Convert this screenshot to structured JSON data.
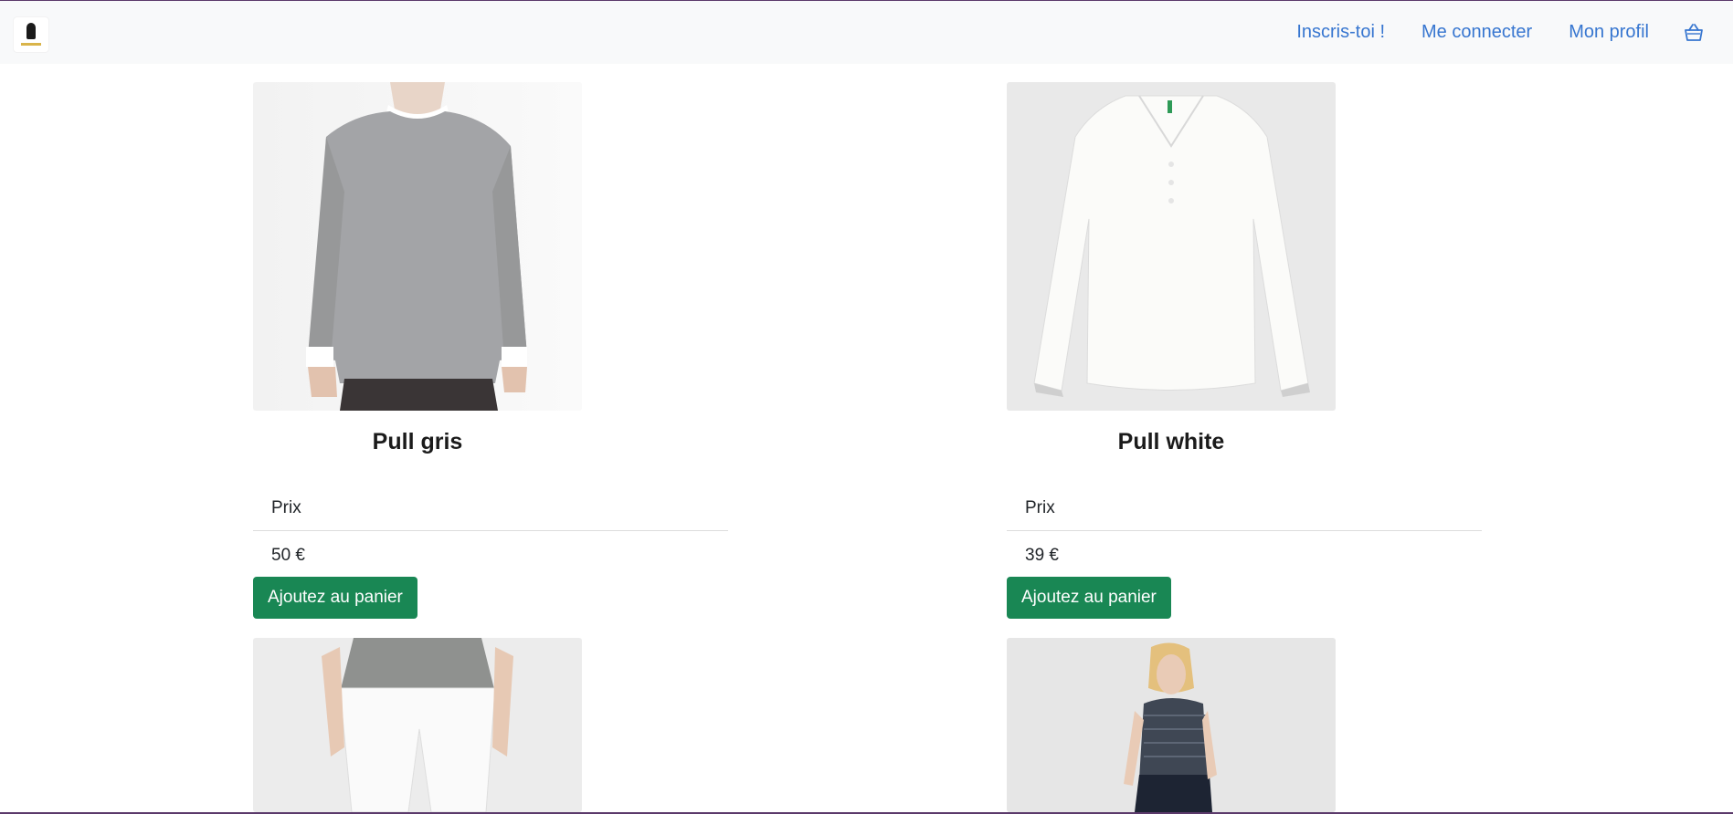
{
  "navbar": {
    "links": [
      "Inscris-toi !",
      "Me connecter",
      "Mon profil"
    ],
    "cart_icon": "basket-icon",
    "link_color": "#3776d0"
  },
  "products": [
    {
      "name": "Pull gris",
      "price_label": "Prix",
      "price": "50 €",
      "button": "Ajoutez au panier"
    },
    {
      "name": "Pull white",
      "price_label": "Prix",
      "price": "39 €",
      "button": "Ajoutez au panier"
    }
  ],
  "colors": {
    "button": "#198754",
    "navbar_bg": "#f8f9fa"
  }
}
